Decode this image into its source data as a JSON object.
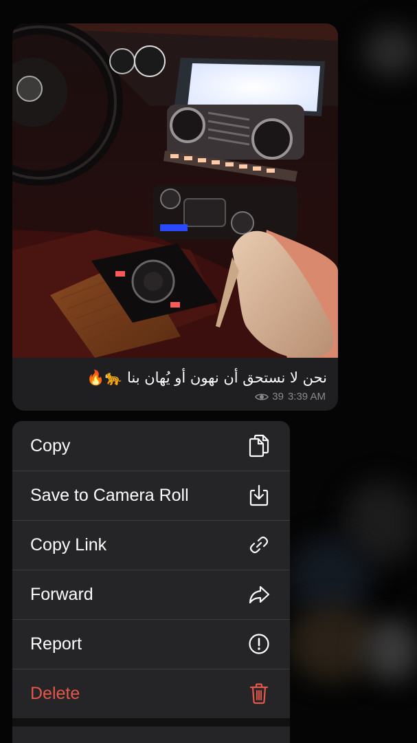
{
  "message": {
    "caption": "نحن لا نستحق أن نهون أو يُهان بنا 🐆🔥",
    "views": "39",
    "time": "3:39 AM",
    "icons": {
      "views": "eye-icon"
    }
  },
  "context_menu": {
    "items": [
      {
        "label": "Copy",
        "icon": "copy-icon",
        "style": "default"
      },
      {
        "label": "Save to Camera Roll",
        "icon": "download-icon",
        "style": "default"
      },
      {
        "label": "Copy Link",
        "icon": "link-icon",
        "style": "default"
      },
      {
        "label": "Forward",
        "icon": "forward-arrow-icon",
        "style": "default"
      },
      {
        "label": "Report",
        "icon": "exclamation-circle-icon",
        "style": "default"
      },
      {
        "label": "Delete",
        "icon": "trash-icon",
        "style": "destructive"
      }
    ]
  },
  "colors": {
    "menu_background": "#252527",
    "bubble_background": "#1f1f21",
    "destructive": "#e5564b",
    "meta_text": "#8a8a8e"
  }
}
